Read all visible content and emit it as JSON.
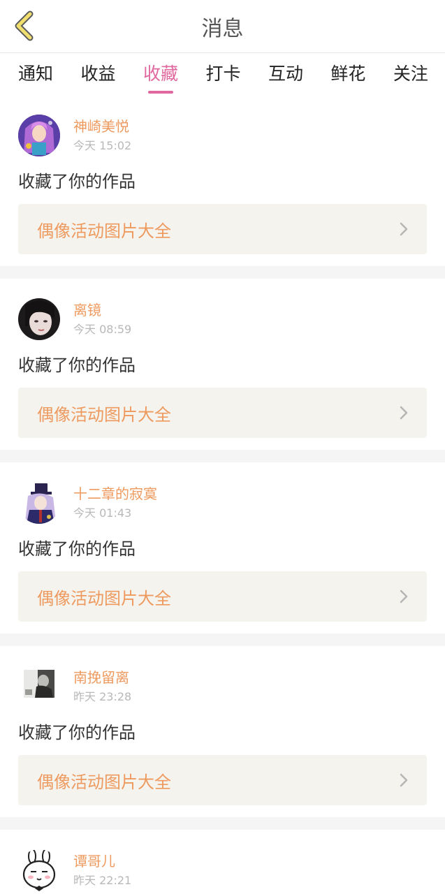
{
  "header": {
    "title": "消息"
  },
  "tabs": [
    {
      "label": "通知",
      "active": false
    },
    {
      "label": "收益",
      "active": false
    },
    {
      "label": "收藏",
      "active": true
    },
    {
      "label": "打卡",
      "active": false
    },
    {
      "label": "互动",
      "active": false
    },
    {
      "label": "鲜花",
      "active": false
    },
    {
      "label": "关注",
      "active": false
    }
  ],
  "messages": [
    {
      "username": "神崎美悦",
      "time": "今天 15:02",
      "action": "收藏了你的作品",
      "work": "偶像活动图片大全",
      "avatar": "anime-girl-purple"
    },
    {
      "username": "离镜",
      "time": "今天 08:59",
      "action": "收藏了你的作品",
      "work": "偶像活动图片大全",
      "avatar": "dark-hair-girl"
    },
    {
      "username": "十二章的寂寞",
      "time": "今天 01:43",
      "action": "收藏了你的作品",
      "work": "偶像活动图片大全",
      "avatar": "anime-top-hat"
    },
    {
      "username": "南挽留离",
      "time": "昨天 23:28",
      "action": "收藏了你的作品",
      "work": "偶像活动图片大全",
      "avatar": "bw-photo"
    },
    {
      "username": "谭哥儿",
      "time": "昨天 22:21",
      "action": "",
      "work": "",
      "avatar": "cartoon-rabbit"
    }
  ],
  "colors": {
    "accent": "#e0689f",
    "username": "#ee9a5f",
    "time": "#b8b8b8",
    "back_icon": "#f0df6e"
  }
}
